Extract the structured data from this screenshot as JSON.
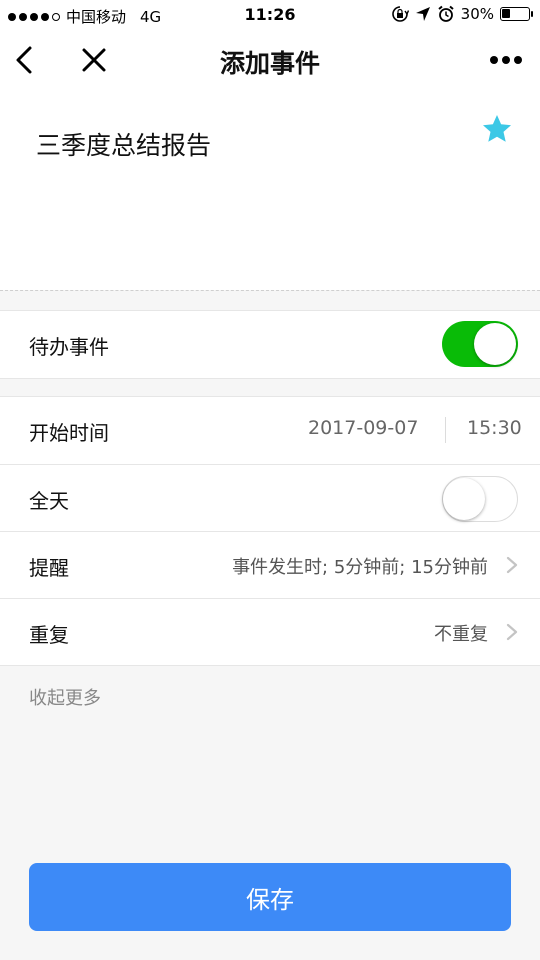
{
  "status_bar": {
    "carrier": "中国移动",
    "network": "4G",
    "time": "11:26",
    "battery_percent": "30%",
    "battery_level": 0.3
  },
  "nav": {
    "title": "添加事件"
  },
  "event": {
    "title": "三季度总结报告",
    "star_color": "#3cc8e6"
  },
  "todo": {
    "label": "待办事件",
    "enabled": true
  },
  "start_time": {
    "label": "开始时间",
    "date": "2017-09-07",
    "time": "15:30"
  },
  "all_day": {
    "label": "全天",
    "enabled": false
  },
  "reminder": {
    "label": "提醒",
    "value": "事件发生时; 5分钟前; 15分钟前"
  },
  "repeat": {
    "label": "重复",
    "value": "不重复"
  },
  "collapse_label": "收起更多",
  "save_label": "保存",
  "colors": {
    "toggle_on": "#09bb07",
    "save_button": "#3d8af7"
  }
}
